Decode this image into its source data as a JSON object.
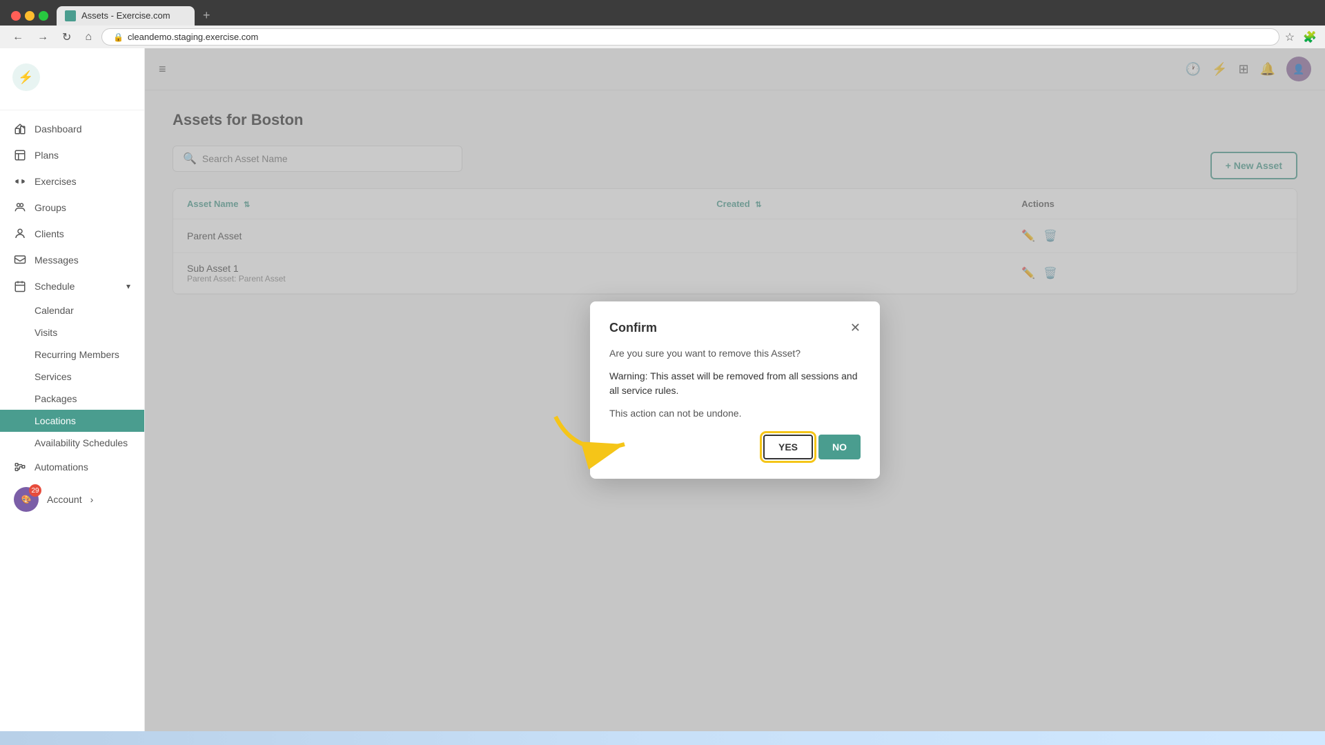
{
  "browser": {
    "tab_title": "Assets - Exercise.com",
    "new_tab_label": "+",
    "address": "cleandemo.staging.exercise.com",
    "nav_back": "←",
    "nav_forward": "→",
    "nav_refresh": "↻",
    "nav_home": "⌂"
  },
  "topbar": {
    "hamburger": "≡"
  },
  "sidebar": {
    "nav_items": [
      {
        "id": "dashboard",
        "label": "Dashboard",
        "icon": "home"
      },
      {
        "id": "plans",
        "label": "Plans",
        "icon": "plans"
      },
      {
        "id": "exercises",
        "label": "Exercises",
        "icon": "exercises"
      },
      {
        "id": "groups",
        "label": "Groups",
        "icon": "groups"
      },
      {
        "id": "clients",
        "label": "Clients",
        "icon": "clients"
      },
      {
        "id": "messages",
        "label": "Messages",
        "icon": "messages"
      }
    ],
    "schedule_section": {
      "label": "Schedule",
      "sub_items": [
        {
          "id": "calendar",
          "label": "Calendar"
        },
        {
          "id": "visits",
          "label": "Visits"
        },
        {
          "id": "recurring-members",
          "label": "Recurring Members"
        },
        {
          "id": "services",
          "label": "Services"
        },
        {
          "id": "packages",
          "label": "Packages"
        },
        {
          "id": "locations",
          "label": "Locations",
          "active": true
        },
        {
          "id": "availability-schedules",
          "label": "Availability Schedules"
        }
      ]
    },
    "automations_label": "Automations",
    "account_label": "Account",
    "account_badge": "29"
  },
  "page": {
    "title": "Assets for Boston",
    "search_placeholder": "Search Asset Name",
    "new_asset_label": "+ New Asset",
    "table": {
      "columns": [
        {
          "id": "asset_name",
          "label": "Asset Name",
          "sortable": true
        },
        {
          "id": "created",
          "label": "Created",
          "sortable": true
        },
        {
          "id": "actions",
          "label": "Actions",
          "sortable": false
        }
      ],
      "rows": [
        {
          "id": 1,
          "name": "Parent Asset",
          "sub": null,
          "created": ""
        },
        {
          "id": 2,
          "name": "Sub Asset 1",
          "sub": "Parent Asset: Parent Asset",
          "created": ""
        }
      ]
    }
  },
  "modal": {
    "title": "Confirm",
    "question": "Are you sure you want to remove this Asset?",
    "warning": "Warning: This asset will be removed from all sessions and all service rules.",
    "undone": "This action can not be undone.",
    "yes_label": "YES",
    "no_label": "NO"
  }
}
